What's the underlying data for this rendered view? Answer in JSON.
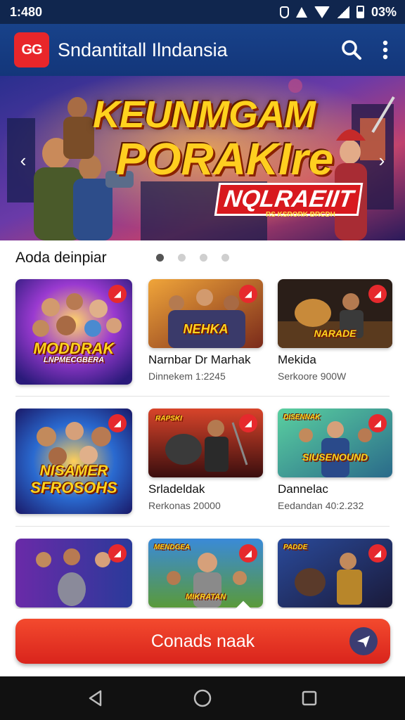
{
  "status_bar": {
    "time": "1:480",
    "battery_text": "03%"
  },
  "app_bar": {
    "logo_text": "GG",
    "title": "Sndantitall Ilndansia"
  },
  "hero": {
    "title_line1": "KEUNMGAM",
    "title_line2": "PORAKIre",
    "subtitle": "NQLRAEIIT",
    "small_text": "RS KSRORK BRCDH"
  },
  "section": {
    "title": "Aoda deinpiar"
  },
  "games": [
    {
      "logo": "MODDRAK",
      "logo_sub": "LNPMECGBERA",
      "name": "",
      "meta": ""
    },
    {
      "logo": "NEHKA",
      "logo_sub": "",
      "name": "Narnbar Dr Marhak",
      "meta": "Dinnekem 1:2245"
    },
    {
      "logo": "NARADE",
      "logo_sub": "",
      "name": "Mekida",
      "meta": "Serkoore 900W"
    },
    {
      "logo": "NISAMER",
      "logo_sub": "SFROSOHS",
      "name": "",
      "meta": ""
    },
    {
      "logo": "RAPSKI",
      "logo_sub": "",
      "name": "Srladeldak",
      "meta": "Rerkonas 20000"
    },
    {
      "logo": "DISENNAK",
      "logo_sub": "SIUSENOUND",
      "name": "Dannelac",
      "meta": "Eedandan 40:2.232"
    },
    {
      "logo": "",
      "logo_sub": "",
      "name": "",
      "meta": ""
    },
    {
      "logo": "MENDGEA",
      "logo_sub": "MIKRATAN",
      "name": "",
      "meta": ""
    },
    {
      "logo": "PADDE",
      "logo_sub": "",
      "name": "",
      "meta": ""
    }
  ],
  "cta": {
    "label": "Conads naak"
  },
  "colors": {
    "brand_red": "#e8262a",
    "app_bar": "#18428a",
    "status_bar": "#10264e"
  }
}
